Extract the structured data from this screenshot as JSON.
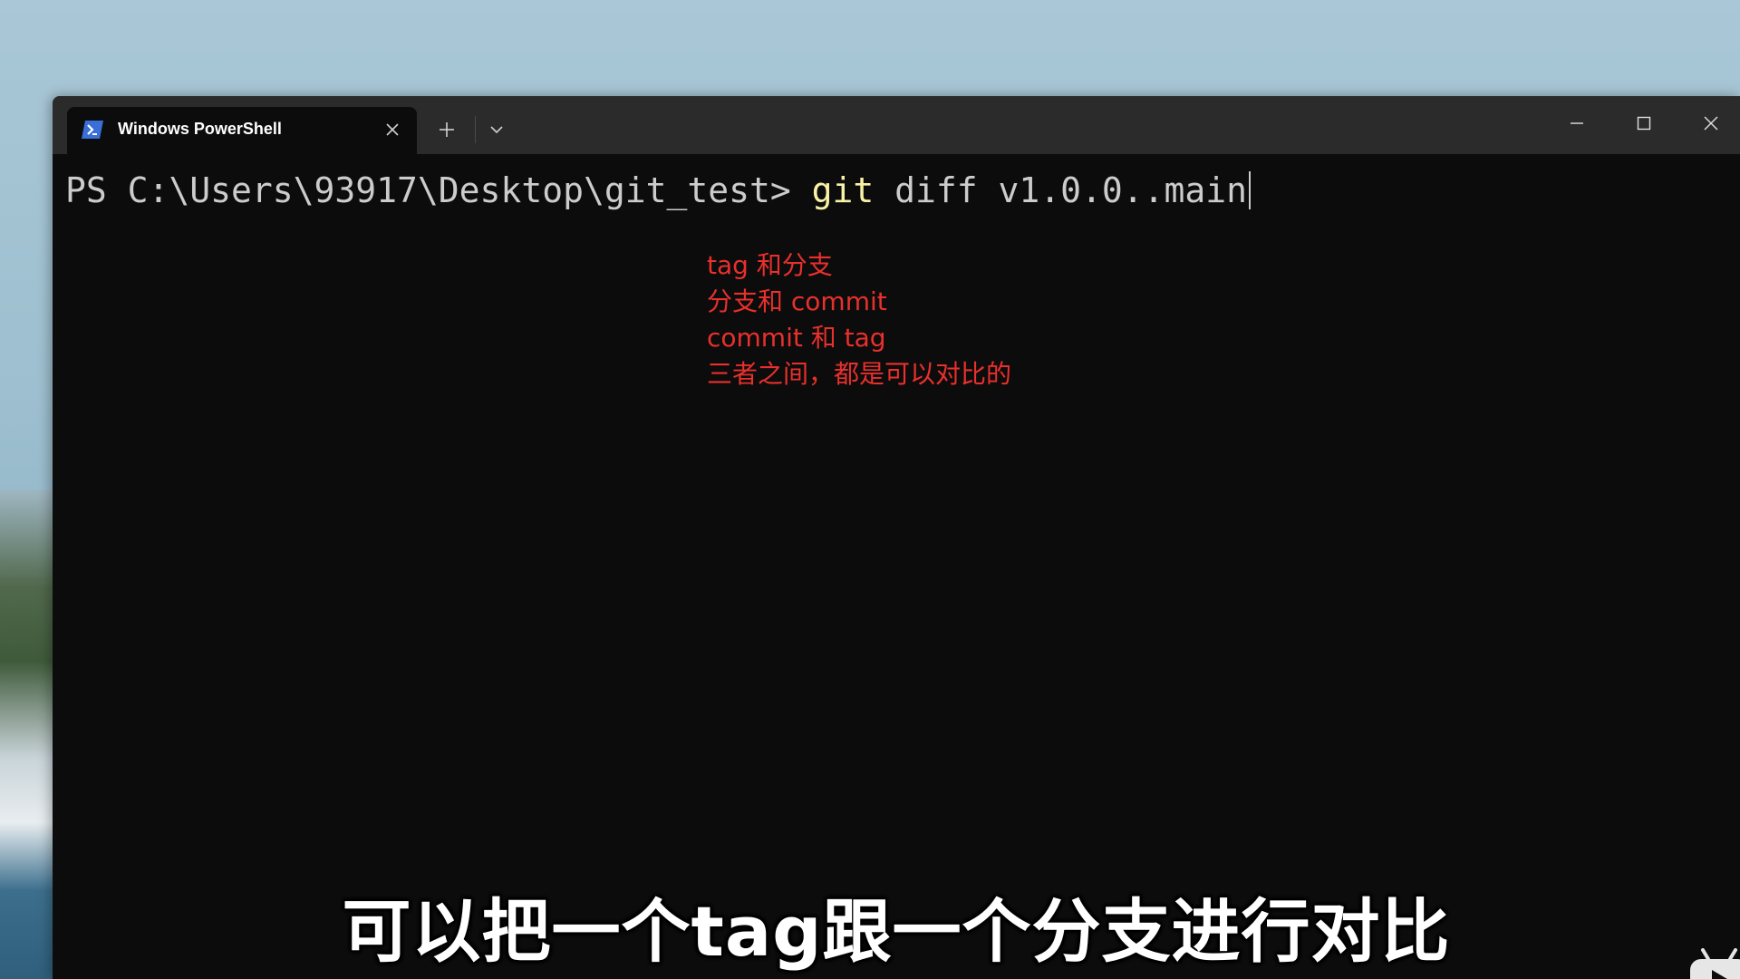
{
  "window": {
    "tab_title": "Windows PowerShell",
    "tab_icon": "powershell-icon",
    "new_tab_icon": "plus-icon",
    "dropdown_icon": "chevron-down-icon",
    "controls": [
      "minimize-icon",
      "maximize-icon",
      "close-icon"
    ]
  },
  "terminal": {
    "prompt": "PS C:\\Users\\93917\\Desktop\\git_test> ",
    "command": "git",
    "args": " diff v1.0.0..main"
  },
  "annotation": {
    "lines": [
      "tag 和分支",
      "分支和 commit",
      "commit 和 tag",
      "三者之间，都是可以对比的"
    ],
    "color": "#e8302c"
  },
  "subtitle": "可以把一个tag跟一个分支进行对比",
  "watermark": {
    "icon": "bilibili-tv-icon"
  },
  "colors": {
    "terminal_bg": "#0c0c0c",
    "titlebar_bg": "#2b2b2b",
    "command": "#f9f1a5",
    "text": "#cccccc"
  }
}
